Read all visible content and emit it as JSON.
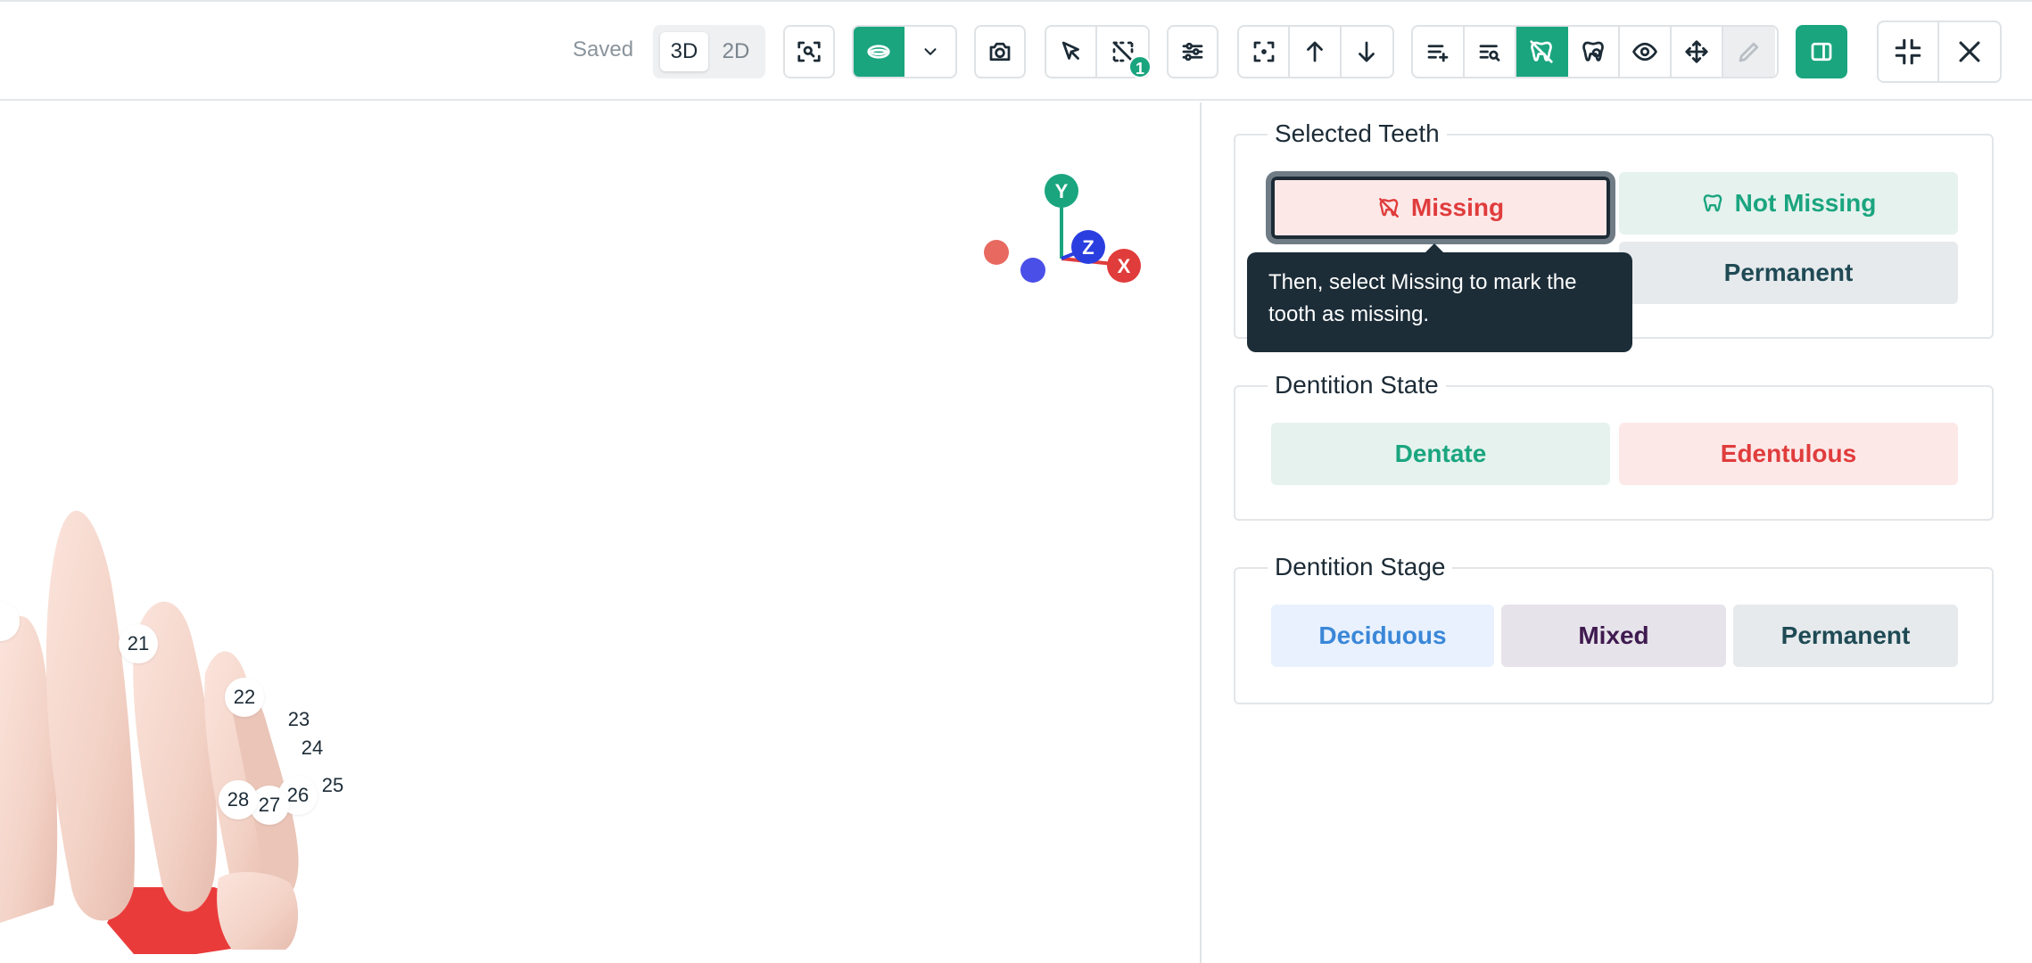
{
  "toolbar": {
    "status": "Saved",
    "view_modes": [
      "3D",
      "2D"
    ],
    "active_view_mode": "3D",
    "selection_count": "1",
    "icons": [
      "zoom-fit-icon",
      "arch-view-icon",
      "chevron-down-icon",
      "camera-icon",
      "select-cursor-icon",
      "deselect-icon",
      "sliders-icon",
      "focus-icon",
      "arrow-up-icon",
      "arrow-down-icon",
      "list-add-icon",
      "list-search-icon",
      "tooth-missing-icon",
      "tooth-mark-icon",
      "eye-icon",
      "move-icon",
      "pencil-icon",
      "panel-toggle-icon",
      "collapse-icon",
      "close-icon"
    ]
  },
  "viewport": {
    "axes": {
      "x": "X",
      "y": "Y",
      "z": "Z"
    },
    "tooth_labels": [
      "21",
      "22",
      "23",
      "24",
      "25",
      "26",
      "27",
      "28"
    ]
  },
  "panel": {
    "selected_teeth": {
      "title": "Selected Teeth",
      "missing_label": "Missing",
      "not_missing_label": "Not Missing",
      "permanent_label": "Permanent"
    },
    "dentition_state": {
      "title": "Dentition State",
      "dentate_label": "Dentate",
      "edentulous_label": "Edentulous"
    },
    "dentition_stage": {
      "title": "Dentition Stage",
      "deciduous_label": "Deciduous",
      "mixed_label": "Mixed",
      "permanent_label": "Permanent"
    }
  },
  "tooltip": {
    "text": "Then, select Missing to mark the tooth as missing."
  },
  "colors": {
    "accent": "#1aa57f",
    "danger": "#e03c3c",
    "tooltip_bg": "#1c2d38"
  }
}
